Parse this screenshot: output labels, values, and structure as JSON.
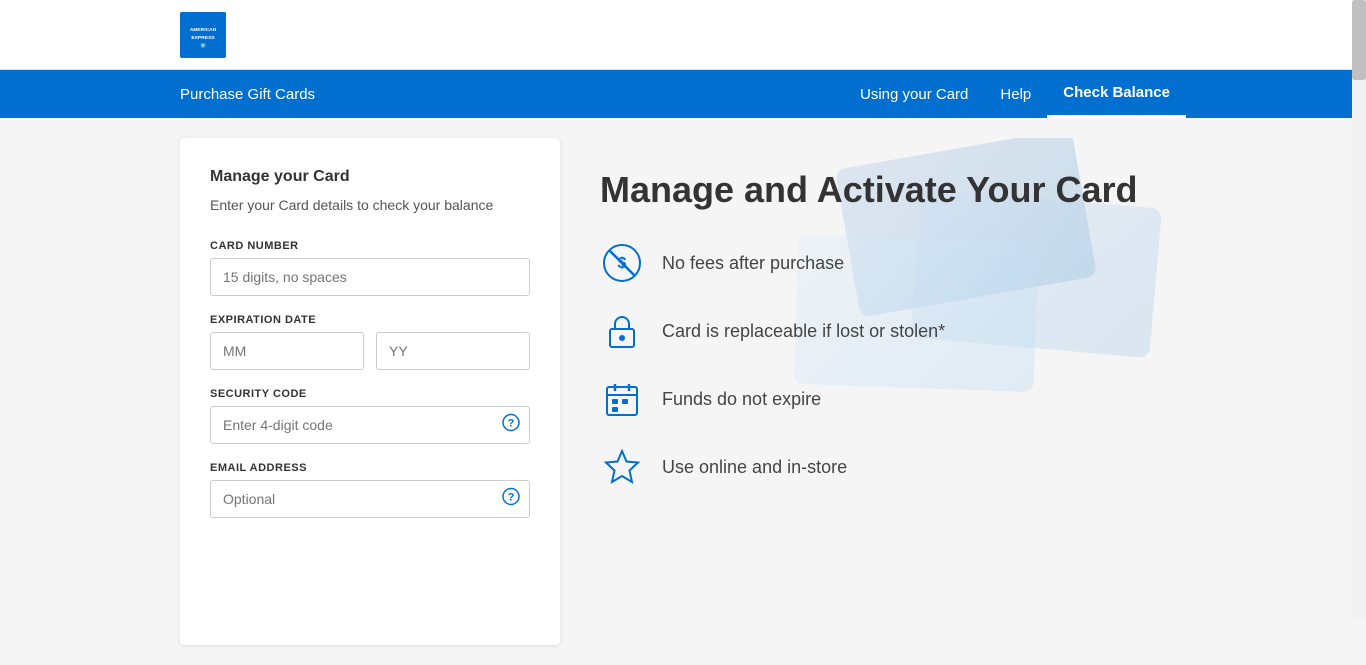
{
  "header": {
    "logo_alt": "American Express"
  },
  "nav": {
    "left_items": [
      {
        "label": "Purchase Gift Cards",
        "active": false
      }
    ],
    "right_items": [
      {
        "label": "Using your Card",
        "active": false
      },
      {
        "label": "Help",
        "active": false
      },
      {
        "label": "Check Balance",
        "active": true
      }
    ]
  },
  "form": {
    "title": "Manage your Card",
    "subtitle": "Enter your Card details to check your balance",
    "fields": {
      "card_number": {
        "label": "CARD NUMBER",
        "placeholder": "15 digits, no spaces"
      },
      "expiration_date": {
        "label": "EXPIRATION DATE",
        "month_placeholder": "MM",
        "year_placeholder": "YY"
      },
      "security_code": {
        "label": "SECURITY CODE",
        "placeholder": "Enter 4-digit code"
      },
      "email_address": {
        "label": "EMAIL ADDRESS",
        "placeholder": "Optional"
      }
    }
  },
  "right_panel": {
    "title": "Manage and Activate Your Card",
    "features": [
      {
        "id": "no-fees",
        "text": "No fees after purchase",
        "icon": "no-fees-icon"
      },
      {
        "id": "replaceable",
        "text": "Card is replaceable if lost or stolen*",
        "icon": "lock-icon"
      },
      {
        "id": "no-expire",
        "text": "Funds do not expire",
        "icon": "calendar-icon"
      },
      {
        "id": "online-store",
        "text": "Use online and in-store",
        "icon": "star-icon"
      }
    ]
  }
}
